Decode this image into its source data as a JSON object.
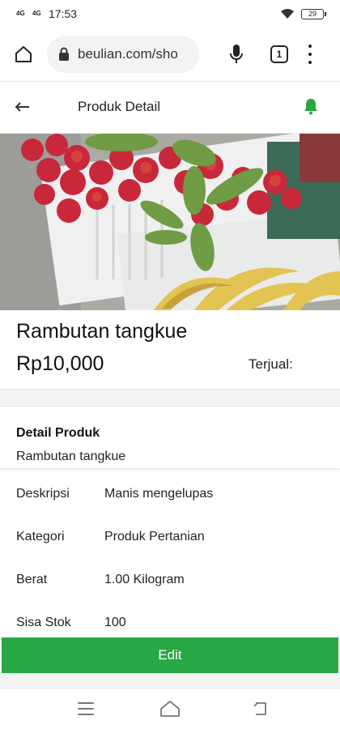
{
  "status_bar": {
    "signal_1": "4G",
    "signal_2": "4G",
    "time": "17:53",
    "battery": "29"
  },
  "browser": {
    "url": "beulian.com/sho",
    "tab_count": "1",
    "icons": [
      "home-icon",
      "lock-icon",
      "mic-icon",
      "tabs-icon",
      "more-vert-icon"
    ]
  },
  "header": {
    "title": "Produk Detail",
    "back_icon": "arrow-left-icon",
    "bell_icon": "bell-icon",
    "accent_color": "#28a745"
  },
  "product": {
    "name": "Rambutan tangkue",
    "price": "Rp10,000",
    "sold_label": "Terjual:"
  },
  "detail": {
    "title": "Detail Produk",
    "subtitle": "Rambutan tangkue",
    "specs": [
      {
        "label": "Deskripsi",
        "value": "Manis mengelupas"
      },
      {
        "label": "Kategori",
        "value": "Produk Pertanian"
      },
      {
        "label": "Berat",
        "value": "1.00 Kilogram"
      },
      {
        "label": "Sisa Stok",
        "value": "100"
      }
    ]
  },
  "actions": {
    "edit_label": "Edit",
    "button_color": "#28a745"
  },
  "nav": {
    "icons": [
      "menu-icon",
      "home-outline-icon",
      "back-icon"
    ]
  }
}
